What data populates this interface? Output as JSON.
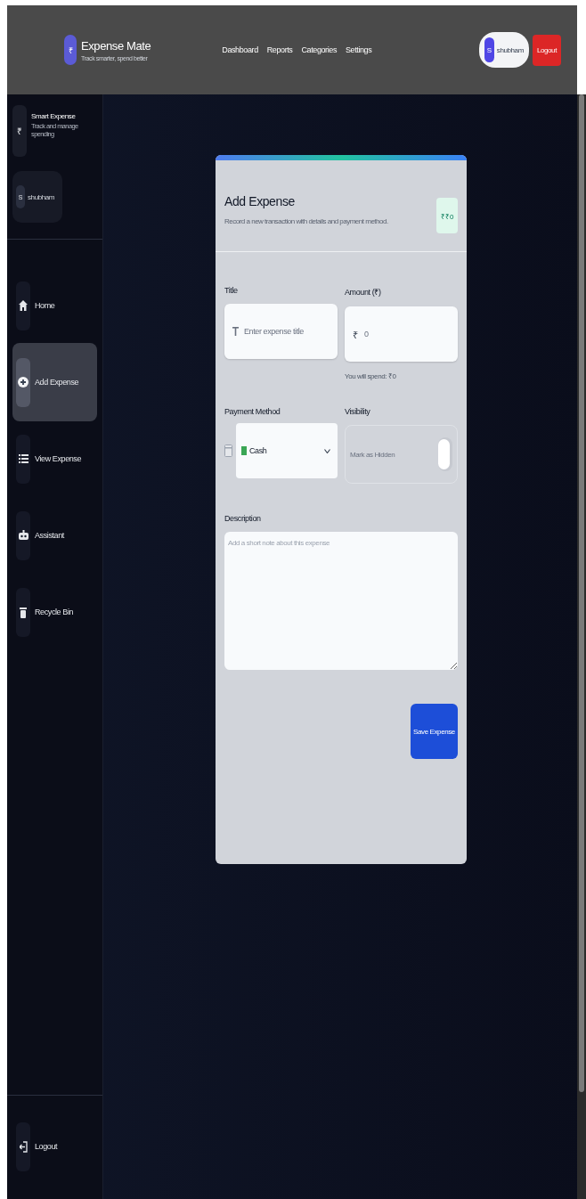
{
  "header": {
    "logo_icon": "₹",
    "app_name": "Expense Mate",
    "tagline": "Track smarter, spend better",
    "nav": [
      "Dashboard",
      "Reports",
      "Categories",
      "Settings"
    ],
    "user": {
      "initial": "S",
      "name": "shubham"
    },
    "logout": "Logout"
  },
  "sidebar": {
    "brand": {
      "icon": "₹",
      "title": "Smart Expense",
      "subtitle": "Track and manage spending"
    },
    "user": {
      "initial": "S",
      "name": "shubham"
    },
    "items": [
      {
        "label": "Home",
        "kind": "home",
        "selected": false
      },
      {
        "label": "Add Expense",
        "kind": "add",
        "selected": true
      },
      {
        "label": "View Expense",
        "kind": "view",
        "selected": false
      },
      {
        "label": "Assistant",
        "kind": "assistant",
        "selected": false
      },
      {
        "label": "Recycle Bin",
        "kind": "bin",
        "selected": false
      }
    ],
    "logout": "Logout"
  },
  "form": {
    "title": "Add Expense",
    "subtitle": "Record a new transaction with details and payment method.",
    "badge_icon": "₹",
    "badge": "₹0",
    "title_field": {
      "label": "Title",
      "placeholder": "Enter expense title"
    },
    "amount_field": {
      "label": "Amount (₹)",
      "prefix": "₹",
      "placeholder": "0",
      "hint": "You will spend: ₹0"
    },
    "payment_field": {
      "label": "Payment Method",
      "value": "Cash"
    },
    "visibility": {
      "label": "Visibility",
      "toggle_label": "Mark as Hidden",
      "on": false
    },
    "description": {
      "label": "Description",
      "placeholder": "Add a short note about this expense"
    },
    "submit": "Save Expense"
  }
}
